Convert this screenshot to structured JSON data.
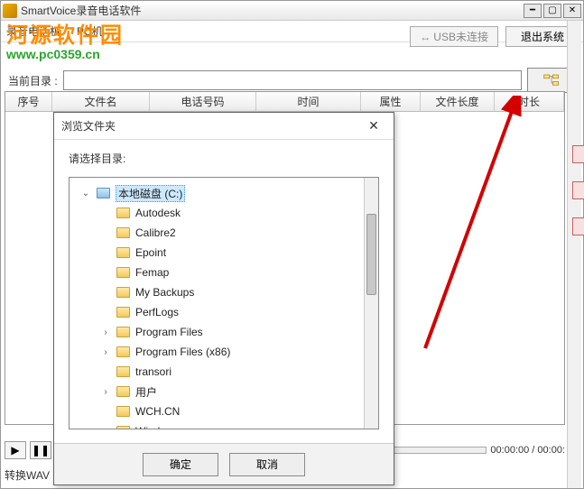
{
  "title": "SmartVoice录音电话软件",
  "menu": {
    "m1": "录音电话机",
    "m2": "PC机"
  },
  "usb": {
    "icon": "↔",
    "label": "USB未连接"
  },
  "exit_label": "退出系统",
  "logo": {
    "line1": "河源软件园",
    "line2": "www.pc0359.cn"
  },
  "curdir": {
    "label": "当前目录 :",
    "value": ""
  },
  "columns": {
    "c0": "序号",
    "c1": "文件名",
    "c2": "电话号码",
    "c3": "时间",
    "c4": "属性",
    "c5": "文件长度",
    "c6": "时长"
  },
  "playtime": "00:00:00 / 00:00:",
  "convert_label": "转换WAV",
  "dialog": {
    "title": "浏览文件夹",
    "prompt": "请选择目录:",
    "ok": "确定",
    "cancel": "取消"
  },
  "tree": {
    "root": "本地磁盘 (C:)",
    "items": [
      "Autodesk",
      "Calibre2",
      "Epoint",
      "Femap",
      "My Backups",
      "PerfLogs",
      "Program Files",
      "Program Files (x86)",
      "transori",
      "用户",
      "WCH.CN",
      "Windows"
    ]
  }
}
